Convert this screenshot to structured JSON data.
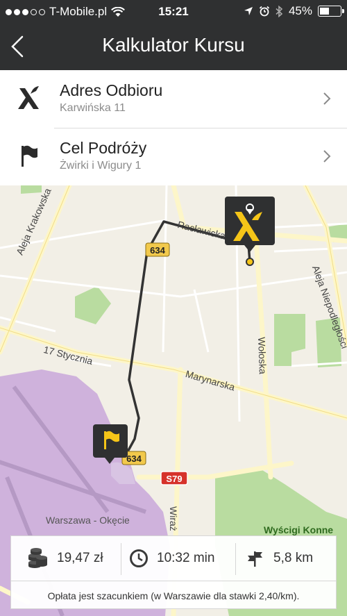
{
  "status_bar": {
    "carrier": "T-Mobile.pl",
    "time": "15:21",
    "battery": "45%",
    "battery_level": 0.45
  },
  "header": {
    "title": "Kalkulator Kursu"
  },
  "pickup": {
    "label": "Adres Odbioru",
    "address": "Karwińska 11"
  },
  "destination": {
    "label": "Cel Podróży",
    "address": "Żwirki i Wigury 1"
  },
  "map": {
    "streets": {
      "krakowska": "Aleja Krakowska",
      "niepodleglosci": "Aleja Niepodległości",
      "styczna": "17 Stycznia",
      "marynarska": "Marynarska",
      "woloska": "Wołoska",
      "raclawicka": "Racławicka",
      "wiraz": "Wiraż"
    },
    "places": {
      "okecie": "Warszawa - Okęcie",
      "wyscigi": "Wyścigi Konne"
    },
    "road_badges": {
      "r634_top": "634",
      "r634_bottom": "634",
      "s79": "S79"
    }
  },
  "info": {
    "price": "19,47 zł",
    "duration": "10:32 min",
    "distance": "5,8 km",
    "note": "Opłata jest szacunkiem (w Warszawie dla stawki 2,40/km)."
  }
}
